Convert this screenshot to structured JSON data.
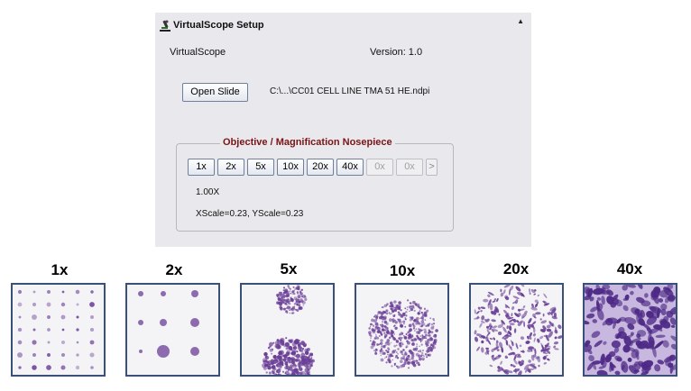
{
  "window": {
    "title": "VirtualScope Setup",
    "collapse_glyph": "▲",
    "app_name": "VirtualScope",
    "version": "Version: 1.0"
  },
  "slide": {
    "open_label": "Open Slide",
    "path": "C:\\...\\CC01 CELL LINE TMA 51 HE.ndpi"
  },
  "nosepiece": {
    "title": "Objective / Magnification Nosepiece",
    "buttons": [
      {
        "label": "1x",
        "enabled": true,
        "selected": true
      },
      {
        "label": "2x",
        "enabled": true
      },
      {
        "label": "5x",
        "enabled": true
      },
      {
        "label": "10x",
        "enabled": true
      },
      {
        "label": "20x",
        "enabled": true
      },
      {
        "label": "40x",
        "enabled": true
      },
      {
        "label": "0x",
        "enabled": false
      },
      {
        "label": "0x",
        "enabled": false
      }
    ],
    "more_glyph": ">",
    "magnification": "1.00X",
    "scale": "XScale=0.23, YScale=0.23"
  },
  "thumbnails": [
    {
      "label": "1x"
    },
    {
      "label": "2x"
    },
    {
      "label": "5x"
    },
    {
      "label": "10x"
    },
    {
      "label": "20x"
    },
    {
      "label": "40x"
    }
  ],
  "colors": {
    "panel_bg": "#e9e9ed",
    "legend_text": "#7a1414",
    "thumb_border": "#3a4f7a",
    "tissue": "#6a3f96"
  },
  "icons": {
    "title_icon": "microscope-icon"
  }
}
